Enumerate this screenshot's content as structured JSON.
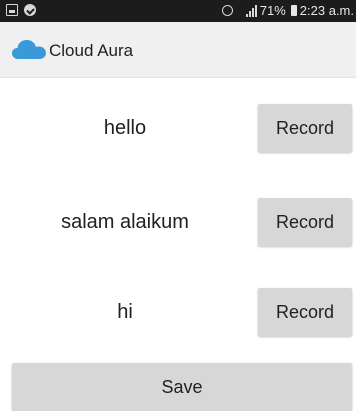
{
  "status_bar": {
    "left_icons": [
      "gallery-icon",
      "check-circle-icon"
    ],
    "right_icons": [
      "alarm-icon",
      "signal-icon"
    ],
    "battery": "71%",
    "time": "2:23 a.m."
  },
  "app_bar": {
    "title": "Cloud Aura",
    "logo_icon": "cloud-icon",
    "logo_color": "#3a9ad9"
  },
  "rows": [
    {
      "text": "hello",
      "button": "Record"
    },
    {
      "text": "salam alaikum",
      "button": "Record"
    },
    {
      "text": "hi",
      "button": "Record"
    }
  ],
  "save_button": "Save",
  "colors": {
    "status_bar_bg": "#1c1c1c",
    "app_bar_bg": "#f0f0f0",
    "button_bg": "#d7d7d7"
  }
}
